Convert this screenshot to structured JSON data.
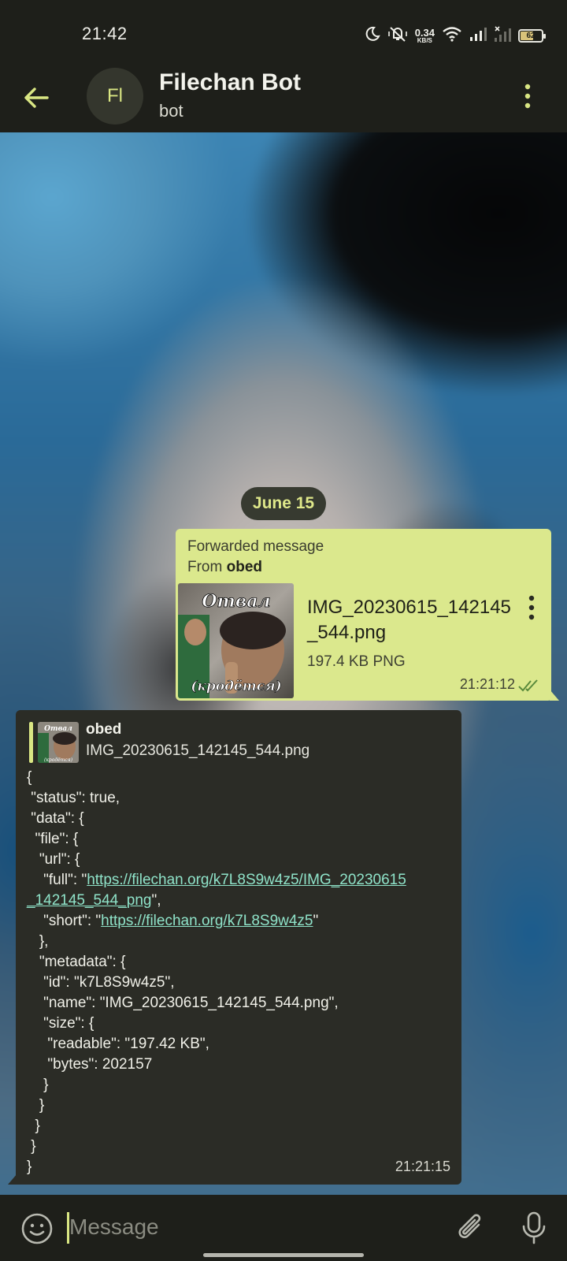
{
  "status_bar": {
    "time": "21:42",
    "net_speed": "0.34",
    "net_speed_unit": "KB/S",
    "battery": "62",
    "battery_level": 0.62,
    "icons": [
      "moon-icon",
      "vibrate-off-icon",
      "wifi-icon",
      "signal-icon",
      "signal-no-sim-icon",
      "battery-icon"
    ]
  },
  "header": {
    "avatar_initials": "Fl",
    "title": "Filechan Bot",
    "subtitle": "bot"
  },
  "date_chip": "June 15",
  "forwarded_message": {
    "label": "Forwarded message",
    "from_prefix": "From ",
    "from_name": "obed",
    "thumbnail_caption_top": "Отвал",
    "thumbnail_caption_bottom": "(кродётся)",
    "file_name": "IMG_20230615_142145_544.png",
    "file_meta": "197.4 KB PNG",
    "time": "21:21:12"
  },
  "reply_message": {
    "quoted_author": "obed",
    "quoted_text": "IMG_20230615_142145_544.png",
    "thumbnail_caption_top": "Отвал",
    "thumbnail_caption_bottom": "(кродётся)",
    "json_lines": [
      "{",
      " \"status\": true,",
      " \"data\": {",
      "  \"file\": {",
      "   \"url\": {"
    ],
    "full_prefix": "    \"full\": \"",
    "full_url_line1": "https://filechan.org/k7L8S9w4z5/IMG_20230615",
    "full_url_line2": "_142145_544_png",
    "full_suffix": "\",",
    "short_prefix": "    \"short\": \"",
    "short_url": "https://filechan.org/k7L8S9w4z5",
    "short_suffix": "\"",
    "json_lines_after": [
      "   },",
      "   \"metadata\": {",
      "    \"id\": \"k7L8S9w4z5\",",
      "    \"name\": \"IMG_20230615_142145_544.png\",",
      "    \"size\": {",
      "     \"readable\": \"197.42 KB\",",
      "     \"bytes\": 202157",
      "    }",
      "   }",
      "  }",
      " }",
      "}"
    ],
    "time": "21:21:15"
  },
  "input_bar": {
    "placeholder": "Message"
  },
  "colors": {
    "accent": "#d9e683",
    "outgoing_bubble": "#dbe88d",
    "incoming_bubble": "#2b2c26",
    "bar_background": "#1e1f1a",
    "link": "#8fe3c9"
  }
}
